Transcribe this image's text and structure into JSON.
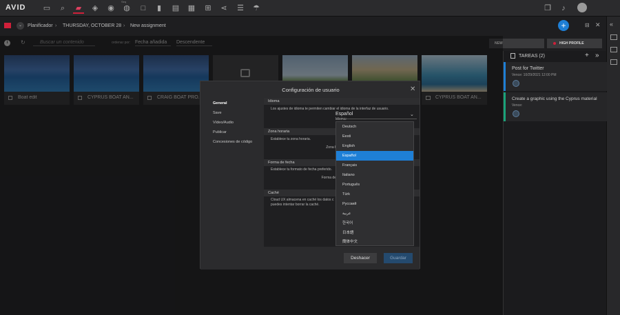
{
  "toolbar": {
    "logo": "AVID",
    "tiny_label": "Seq"
  },
  "breadcrumb": {
    "app": "Planificador",
    "date": "THURSDAY, OCTOBER 28",
    "item": "New assignment"
  },
  "filter": {
    "search_placeholder": "Buscar un contenido",
    "sort_label": "ordenar por:",
    "sort_value": "Fecha añadida",
    "order_value": "Descendente"
  },
  "cards": [
    {
      "caption": "Boat edit",
      "icon": "sequence-icon"
    },
    {
      "caption": "CYPRUS BOAT AN...",
      "icon": "image-icon"
    },
    {
      "caption": "CRAIG BOAT PRO...",
      "icon": "image-icon"
    },
    {
      "caption": "",
      "icon": "collection-icon"
    },
    {
      "caption": "",
      "icon": "video-icon"
    },
    {
      "caption": "",
      "icon": "video-icon"
    },
    {
      "caption": "CYPRUS BOAT AN...",
      "icon": "video-icon"
    }
  ],
  "right_panel": {
    "new_label": "NEW",
    "profile_label": "HIGH PROFILE",
    "tasks_title": "TAREAS (2)",
    "tasks": [
      {
        "title": "Post for Twitter",
        "meta": "Vence: 10/29/2021 12:00 PM",
        "color": "#1e7fd6"
      },
      {
        "title": "Create a graphic using the Cyprus material",
        "meta": "Vence:",
        "color": "#1aa37a"
      }
    ]
  },
  "dialog": {
    "title": "Configuración de usuario",
    "nav": [
      "General",
      "Save",
      "Vídeo/Audio",
      "Publicar",
      "Concesiones de código"
    ],
    "sections": {
      "idioma_head": "Idioma",
      "idioma_text": "Los ajustes de idioma te permiten cambiar el idioma de la interfaz de usuario.",
      "idioma_label": "Idioma:",
      "idioma_value": "Español",
      "zona_head": "Zona horaria",
      "zona_text": "Establece tu zona horaria.",
      "zona_label": "Zona horaria:",
      "fecha_head": "Forma de fecha",
      "fecha_text": "Establece tu formato de fecha preferido.",
      "fecha_label": "Forma de fecha:",
      "cache_head": "Caché",
      "cache_text1": "Cloud UX almacena en caché los datos c",
      "cache_text2": "puedes intentar borrar la caché."
    },
    "undo_label": "Deshacer",
    "save_label": "Guardar"
  },
  "language_options": [
    "Deutsch",
    "Eesti",
    "English",
    "Español",
    "Français",
    "Italiano",
    "Português",
    "Türk",
    "Русский",
    "عربية",
    "한국어",
    "日本語",
    "簡体中文"
  ],
  "selected_language": "Español"
}
